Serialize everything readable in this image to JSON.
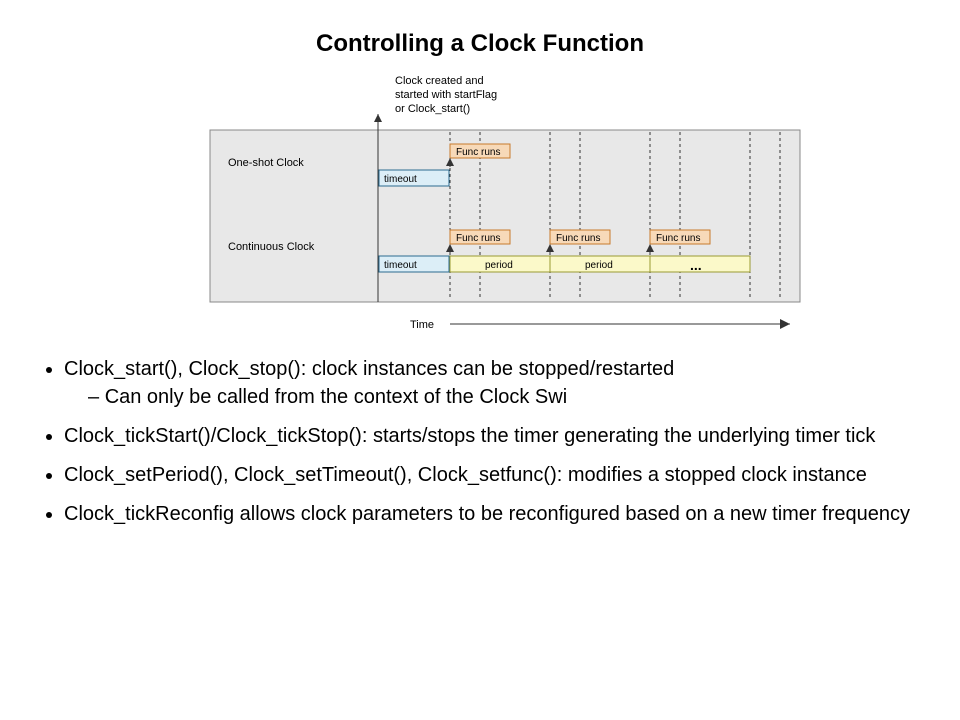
{
  "title": "Controlling a Clock Function",
  "diagram": {
    "annotation": {
      "line1": "Clock created and",
      "line2": "started with startFlag",
      "line3": "or Clock_start()"
    },
    "oneShotLabel": "One-shot Clock",
    "continuousLabel": "Continuous Clock",
    "timeLabel": "Time",
    "timeout": "timeout",
    "funcRuns": "Func runs",
    "period": "period",
    "ellipsis": "..."
  },
  "bullets": [
    {
      "text": "Clock_start(), Clock_stop(): clock instances can be stopped/restarted",
      "children": [
        "Can only be called from the context of the Clock Swi"
      ]
    },
    {
      "text": "Clock_tickStart()/Clock_tickStop(): starts/stops the timer generating the underlying timer tick",
      "children": []
    },
    {
      "text": "Clock_setPeriod(), Clock_setTimeout(), Clock_setfunc(): modifies a stopped clock instance",
      "children": []
    },
    {
      "text": "Clock_tickReconfig allows clock parameters to be reconfigured based on a new timer frequency",
      "children": []
    }
  ],
  "chart_data": {
    "type": "diagram",
    "title": "Controlling a Clock Function",
    "axis": "Time",
    "start_event": "Clock created and started with startFlag or Clock_start()",
    "tracks": [
      {
        "name": "One-shot Clock",
        "sequence": [
          "timeout",
          "Func runs"
        ]
      },
      {
        "name": "Continuous Clock",
        "sequence": [
          "timeout",
          "Func runs",
          "period",
          "Func runs",
          "period",
          "Func runs",
          "..."
        ]
      }
    ]
  }
}
